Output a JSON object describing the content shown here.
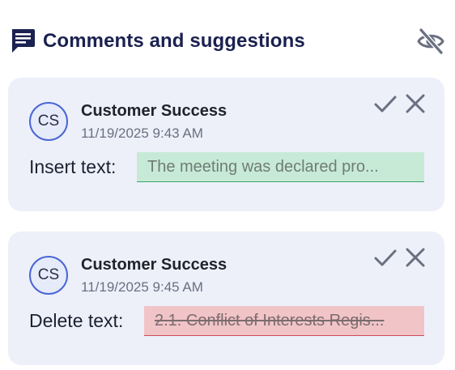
{
  "header": {
    "title": "Comments and suggestions",
    "icon": "comment-icon",
    "hide_icon": "eye-off-icon"
  },
  "suggestions": [
    {
      "avatar_initials": "CS",
      "author": "Customer Success",
      "timestamp": "11/19/2025 9:43 AM",
      "change_label": "Insert text:",
      "change_text": "The meeting was declared pro...",
      "type": "insert",
      "accept_icon": "check-icon",
      "reject_icon": "close-icon"
    },
    {
      "avatar_initials": "CS",
      "author": "Customer Success",
      "timestamp": "11/19/2025 9:45 AM",
      "change_label": "Delete text:",
      "change_text": "2.1. Conflict of Interests Regis...",
      "type": "delete",
      "accept_icon": "check-icon",
      "reject_icon": "close-icon"
    }
  ],
  "colors": {
    "title": "#1b2150",
    "card_background": "#edf0f9",
    "avatar_border": "#4a66d6",
    "insert_highlight": "#c7ead6",
    "delete_highlight": "#f1c4c7",
    "icon": "#6b7080"
  }
}
